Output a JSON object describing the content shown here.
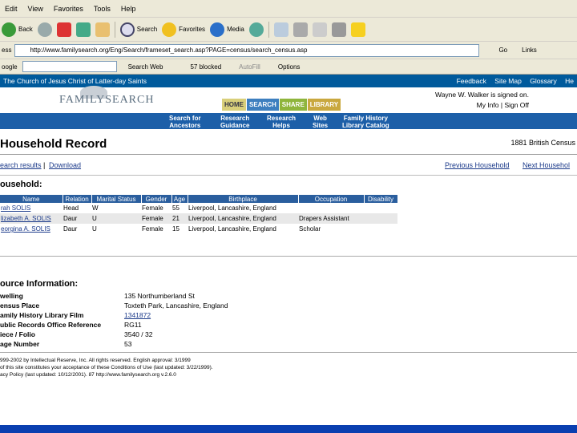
{
  "menu": [
    "Edit",
    "View",
    "Favorites",
    "Tools",
    "Help"
  ],
  "toolbar": {
    "back": "Back",
    "search": "Search",
    "favorites": "Favorites",
    "media": "Media"
  },
  "address": {
    "url": "http://www.familysearch.org/Eng/Search/frameset_search.asp?PAGE=census/search_census.asp",
    "label": "ess",
    "go": "Go",
    "links": "Links"
  },
  "google": {
    "label": "oogle",
    "search_web": "Search Web",
    "blocked": "57 blocked",
    "autofill": "AutoFill",
    "options": "Options"
  },
  "site": {
    "church": "The Church of Jesus Christ of Latter-day Saints",
    "toplinks": [
      "Feedback",
      "Site Map",
      "Glossary",
      "He"
    ],
    "logo": "FAMILYSEARCH",
    "tabs": [
      "HOME",
      "SEARCH",
      "SHARE",
      "LIBRARY"
    ],
    "signed_in": "Wayne W. Walker is signed on.",
    "my_info": "My Info",
    "sign_off": "Sign Off",
    "subnav": [
      [
        "Search for",
        "Ancestors"
      ],
      [
        "Research",
        "Guidance"
      ],
      [
        "Research",
        "Helps"
      ],
      [
        "Web",
        "Sites"
      ],
      [
        "Family History",
        "Library Catalog"
      ]
    ]
  },
  "record": {
    "title": "Household Record",
    "census": "1881 British Census",
    "search_results": "earch results",
    "download": "Download",
    "prev": "Previous Household",
    "next": "Next Househol",
    "household_heading": "ousehold:",
    "columns": [
      "Name",
      "Relation",
      "Marital Status",
      "Gender",
      "Age",
      "Birthplace",
      "Occupation",
      "Disability"
    ],
    "rows": [
      {
        "name": "rah SOLIS",
        "relation": "Head",
        "marital": "W",
        "gender": "Female",
        "age": "55",
        "birthplace": "Liverpool, Lancashire, England",
        "occupation": "",
        "disability": ""
      },
      {
        "name": "lizabeth A. SOLIS",
        "relation": "Daur",
        "marital": "U",
        "gender": "Female",
        "age": "21",
        "birthplace": "Liverpool, Lancashire, England",
        "occupation": "Drapers Assistant",
        "disability": ""
      },
      {
        "name": "eorgina A. SOLIS",
        "relation": "Daur",
        "marital": "U",
        "gender": "Female",
        "age": "15",
        "birthplace": "Liverpool, Lancashire, England",
        "occupation": "Scholar",
        "disability": ""
      }
    ],
    "source_heading": "ource Information:",
    "source": [
      {
        "k": "welling",
        "v": "135 Northumberland St"
      },
      {
        "k": "ensus Place",
        "v": "Toxteth Park, Lancashire, England"
      },
      {
        "k": "amily History Library Film",
        "v": "1341872"
      },
      {
        "k": "ublic Records Office Reference",
        "v": "RG11"
      },
      {
        "k": "iece / Folio",
        "v": "3540 / 32"
      },
      {
        "k": "age Number",
        "v": "53"
      }
    ],
    "footer": [
      "999-2002 by Intellectual Reserve, Inc. All rights reserved. English approval: 3/1999",
      "of this site constitutes your acceptance of these Conditions of Use (last updated: 3/22/1999).",
      "acy Policy (last updated: 10/12/2001).   87   http://www.familysearch.org  v.2.6.0"
    ]
  }
}
